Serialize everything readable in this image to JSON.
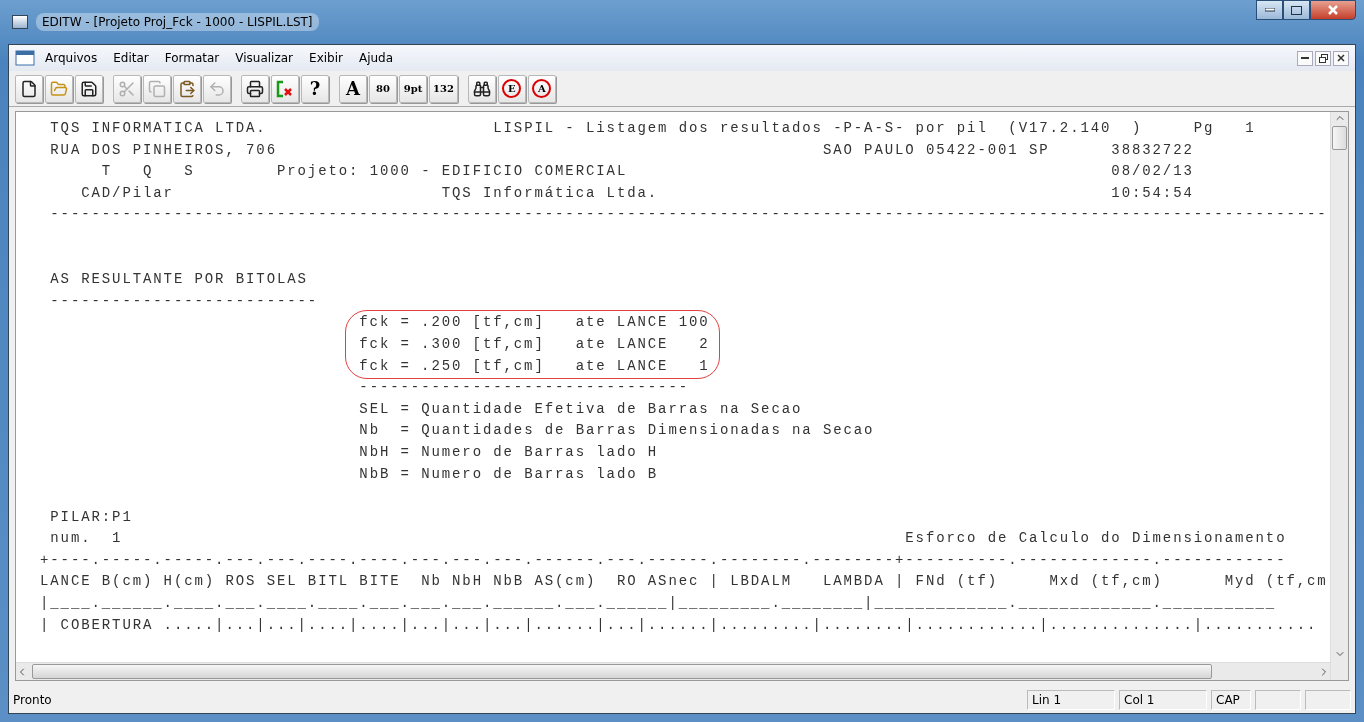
{
  "window": {
    "title": "EDITW - [Projeto Proj_Fck - 1000 - LISPIL.LST]"
  },
  "menu": [
    "Arquivos",
    "Editar",
    "Formatar",
    "Visualizar",
    "Exibir",
    "Ajuda"
  ],
  "toolbar": [
    {
      "kind": "new",
      "disabled": false
    },
    {
      "kind": "open",
      "disabled": false
    },
    {
      "kind": "save",
      "disabled": false
    },
    {
      "kind": "sep"
    },
    {
      "kind": "cut",
      "disabled": true
    },
    {
      "kind": "copy",
      "disabled": true
    },
    {
      "kind": "paste",
      "disabled": false
    },
    {
      "kind": "undo",
      "disabled": true
    },
    {
      "kind": "sep"
    },
    {
      "kind": "print",
      "disabled": false
    },
    {
      "kind": "exit",
      "disabled": false
    },
    {
      "kind": "text",
      "label": "?",
      "disabled": false
    },
    {
      "kind": "sep"
    },
    {
      "kind": "text",
      "label": "A",
      "disabled": false
    },
    {
      "kind": "text",
      "label": "80",
      "disabled": false
    },
    {
      "kind": "text",
      "label": "9pt",
      "disabled": false
    },
    {
      "kind": "text",
      "label": "132",
      "disabled": false
    },
    {
      "kind": "sep"
    },
    {
      "kind": "find",
      "disabled": false
    },
    {
      "kind": "circle",
      "label": "E",
      "disabled": false
    },
    {
      "kind": "circle",
      "label": "A",
      "disabled": false
    }
  ],
  "listing": [
    {
      "kind": "line",
      "text": " TQS INFORMATICA LTDA.                      LISPIL - Listagem dos resultados -P-A-S- por pil  (V17.2.140  )     Pg   1"
    },
    {
      "kind": "line",
      "text": " RUA DOS PINHEIROS, 706                                                     SAO PAULO 05422-001 SP      38832722"
    },
    {
      "kind": "line",
      "text": "      T   Q   S        Projeto: 1000 - EDIFICIO COMERCIAL                                               08/02/13"
    },
    {
      "kind": "line",
      "text": "    CAD/Pilar                          TQS Informática Ltda.                                            10:54:54"
    },
    {
      "kind": "line",
      "text": " ----------------------------------------------------------------------------------------------------------------------------"
    },
    {
      "kind": "blank"
    },
    {
      "kind": "blank"
    },
    {
      "kind": "line",
      "text": " AS RESULTANTE POR BITOLAS"
    },
    {
      "kind": "line",
      "text": " --------------------------"
    },
    {
      "kind": "highlight",
      "lines": [
        "fck = .200 [tf,cm]   ate LANCE 100",
        "fck = .300 [tf,cm]   ate LANCE   2",
        "fck = .250 [tf,cm]   ate LANCE   1"
      ]
    },
    {
      "kind": "line",
      "text": "                               --------------------------------"
    },
    {
      "kind": "line",
      "text": "                               SEL = Quantidade Efetiva de Barras na Secao"
    },
    {
      "kind": "line",
      "text": "                               Nb  = Quantidades de Barras Dimensionadas na Secao"
    },
    {
      "kind": "line",
      "text": "                               NbH = Numero de Barras lado H"
    },
    {
      "kind": "line",
      "text": "                               NbB = Numero de Barras lado B"
    },
    {
      "kind": "blank"
    },
    {
      "kind": "line",
      "text": " PILAR:P1"
    },
    {
      "kind": "line",
      "text": " num.  1                                                                            Esforco de Calculo do Dimensionamento"
    },
    {
      "kind": "line",
      "text": "+----.-----.-----.---.---.----.----.---.---.---.------.---.------.--------.--------+----------.-------------.------------"
    },
    {
      "kind": "line",
      "text": "LANCE B(cm) H(cm) ROS SEL BITL BITE  Nb NbH NbB AS(cm)  RO ASnec | LBDALM   LAMBDA | FNd (tf)     Mxd (tf,cm)      Myd (tf,cm"
    },
    {
      "kind": "line",
      "text": "|____.______.____.___.____.____.___.___.___.______.___.______|_________.________|_____________._____________.___________"
    },
    {
      "kind": "line",
      "text": "| COBERTURA .....|...|...|....|....|...|...|...|......|...|......|.........|........|............|..............|..........."
    }
  ],
  "status_bar": {
    "message": "Pronto",
    "panels": [
      "Lin 1",
      "Col 1",
      "CAP"
    ]
  }
}
